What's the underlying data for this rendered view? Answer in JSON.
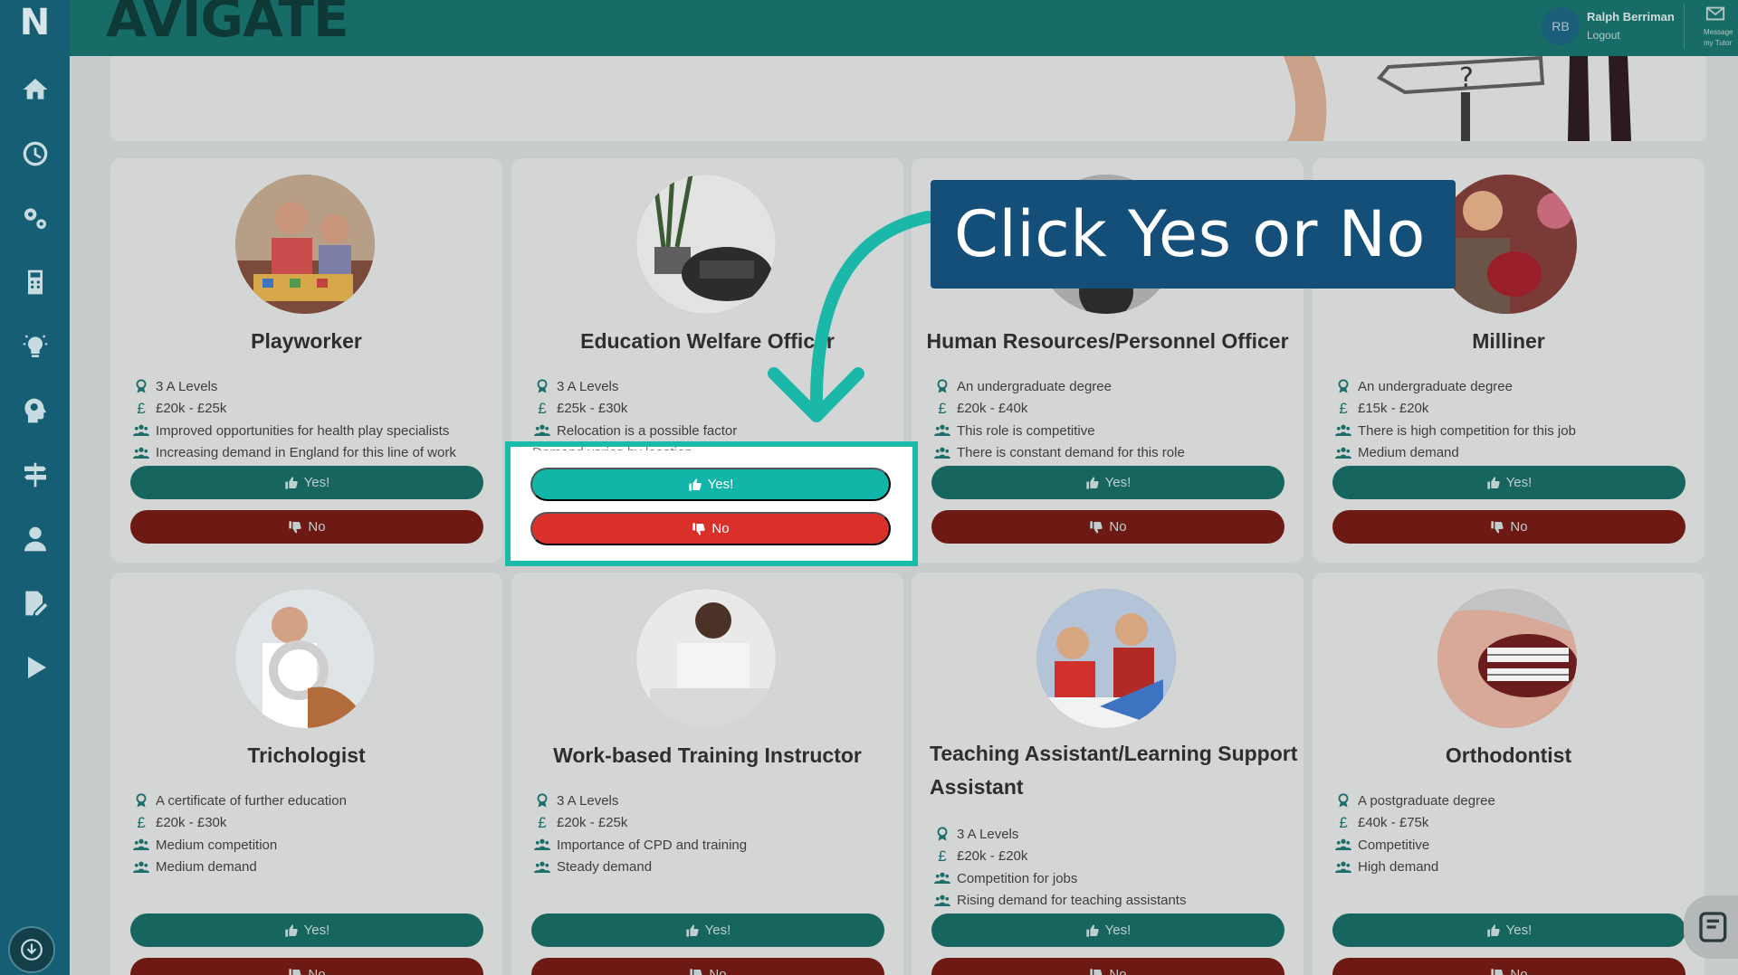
{
  "app": {
    "brand": "AVIGATE",
    "logo_letter": "N"
  },
  "sidebar": {
    "items": [
      {
        "icon": "home-icon",
        "name": "sidebar-item-home"
      },
      {
        "icon": "clock-icon",
        "name": "sidebar-item-history"
      },
      {
        "icon": "gears-icon",
        "name": "sidebar-item-settings"
      },
      {
        "icon": "calculator-icon",
        "name": "sidebar-item-calculator"
      },
      {
        "icon": "lightbulb-icon",
        "name": "sidebar-item-ideas"
      },
      {
        "icon": "head-profile-icon",
        "name": "sidebar-item-profile-insights"
      },
      {
        "icon": "signpost-icon",
        "name": "sidebar-item-pathways"
      },
      {
        "icon": "user-icon",
        "name": "sidebar-item-account"
      },
      {
        "icon": "edit-document-icon",
        "name": "sidebar-item-notes"
      },
      {
        "icon": "play-icon",
        "name": "sidebar-item-videos"
      }
    ],
    "bottom_icon": "download-icon"
  },
  "topbar": {
    "user_initials": "RB",
    "user_name": "Ralph Berriman",
    "logout_label": "Logout",
    "message_label": "Message my Tutor"
  },
  "callout": {
    "text": "Click Yes or No"
  },
  "buttons": {
    "yes_label": "Yes!",
    "no_label": "No"
  },
  "jobs": [
    {
      "title": "Playworker",
      "facts": [
        "3 A Levels",
        "£20k - £25k",
        "Improved opportunities for health play specialists",
        "Increasing demand in England for this line of work"
      ]
    },
    {
      "title": "Education Welfare Officer",
      "facts": [
        "3 A Levels",
        "£25k - £30k",
        "Relocation is a possible factor",
        "Demand varies by location"
      ]
    },
    {
      "title": "Human Resources/Personnel Officer",
      "facts": [
        "An undergraduate degree",
        "£20k - £40k",
        "This role is competitive",
        "There is constant demand for this role"
      ]
    },
    {
      "title": "Milliner",
      "facts": [
        "An undergraduate degree",
        "£15k - £20k",
        "There is high competition for this job",
        "Medium demand"
      ]
    },
    {
      "title": "Trichologist",
      "facts": [
        "A certificate of further education",
        "£20k - £30k",
        "Medium competition",
        "Medium demand"
      ]
    },
    {
      "title": "Work-based Training Instructor",
      "facts": [
        "3 A Levels",
        "£20k - £25k",
        "Importance of CPD and training",
        "Steady demand"
      ]
    },
    {
      "title": "Teaching Assistant/Learning Support Assistant",
      "facts": [
        "3 A Levels",
        "£20k - £20k",
        "Competition for jobs",
        "Rising demand for teaching assistants"
      ]
    },
    {
      "title": "Orthodontist",
      "facts": [
        "A postgraduate degree",
        "£40k - £75k",
        "Competitive",
        "High demand"
      ]
    }
  ],
  "colors": {
    "sidebar": "#155e73",
    "topbar": "#176c67",
    "yes_button": "#12b6a8",
    "no_button": "#d9302a",
    "highlight_border": "#1bbbab",
    "callout_bg": "#134f78"
  }
}
